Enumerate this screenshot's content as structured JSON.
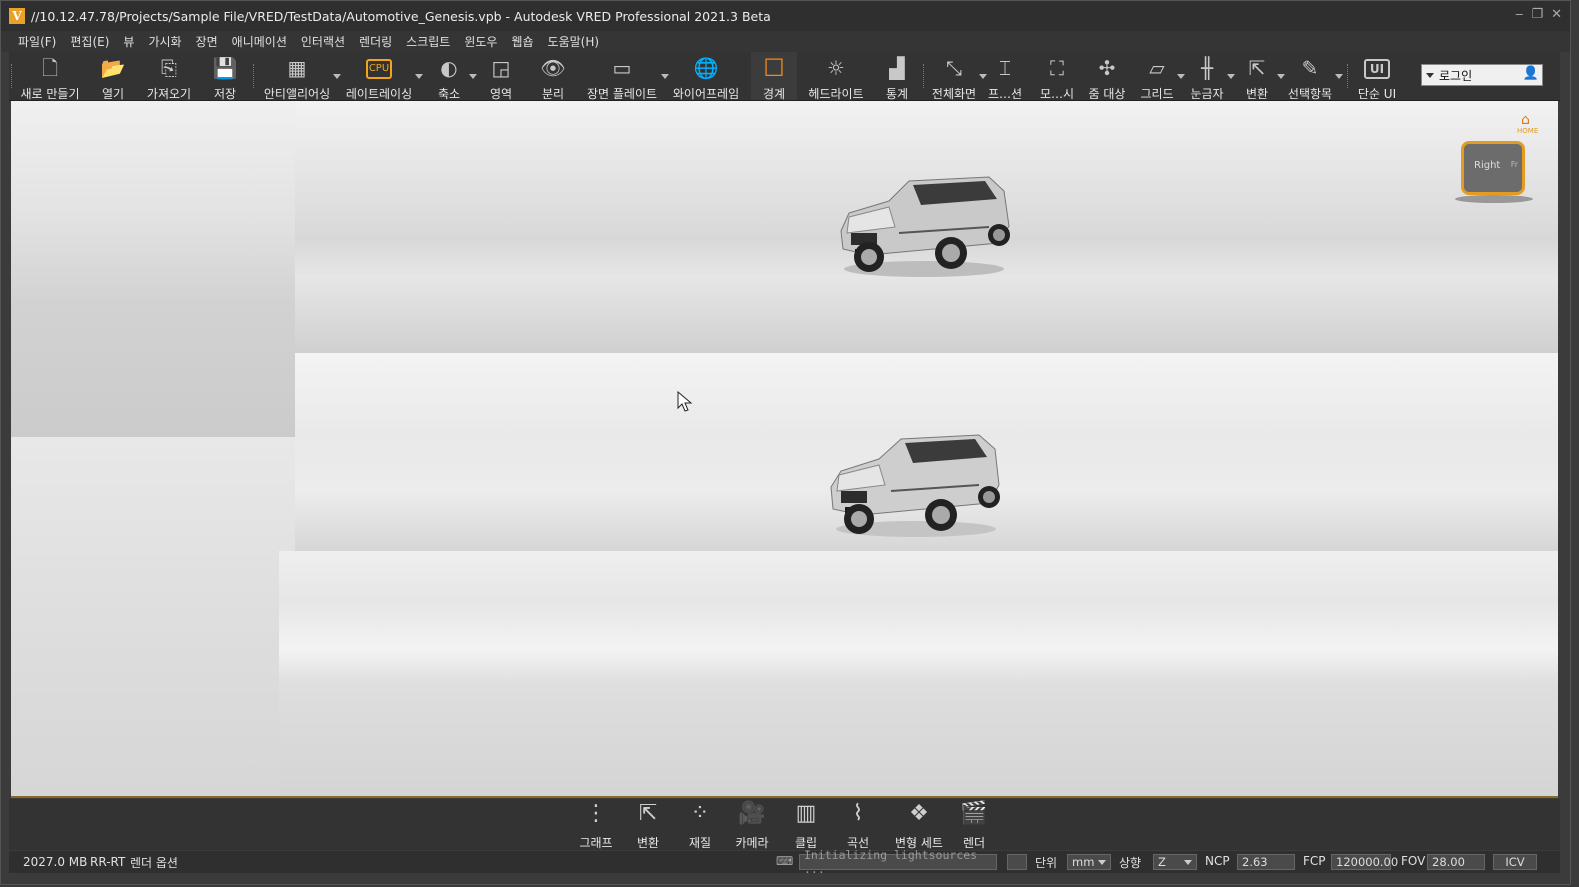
{
  "window": {
    "title": "//10.12.47.78/Projects/Sample File/VRED/TestData/Automotive_Genesis.vpb - Autodesk VRED Professional 2021.3 Beta",
    "logo_letter": "V",
    "controls": [
      "‒",
      "❐",
      "✕"
    ]
  },
  "menu": [
    "파일(F)",
    "편집(E)",
    "뷰",
    "가시화",
    "장면",
    "애니메이션",
    "인터랙션",
    "렌더링",
    "스크립트",
    "윈도우",
    "웹숍",
    "도움말(H)"
  ],
  "toolbar": {
    "buttons": [
      {
        "label": "새로 만들기",
        "icon": "new-file-icon",
        "glyph": "🗋"
      },
      {
        "label": "열기",
        "icon": "open-folder-icon",
        "glyph": "📂"
      },
      {
        "label": "가져오기",
        "icon": "import-icon",
        "glyph": "⎘"
      },
      {
        "label": "저장",
        "icon": "save-icon",
        "glyph": "💾"
      },
      {
        "label": "안티앨리어싱",
        "icon": "antialiasing-icon",
        "glyph": "▦"
      },
      {
        "label": "레이트레이싱",
        "icon": "cpu-icon",
        "glyph": "CPU"
      },
      {
        "label": "축소",
        "icon": "contrast-icon",
        "glyph": "◐"
      },
      {
        "label": "영역",
        "icon": "region-icon",
        "glyph": "◲"
      },
      {
        "label": "분리",
        "icon": "eye-icon",
        "glyph": "👁"
      },
      {
        "label": "장면 플레이트",
        "icon": "scene-plate-icon",
        "glyph": "▭"
      },
      {
        "label": "와이어프레임",
        "icon": "wireframe-globe-icon",
        "glyph": "🌐"
      },
      {
        "label": "경계",
        "icon": "bounding-box-icon",
        "glyph": "☐"
      },
      {
        "label": "헤드라이트",
        "icon": "headlight-icon",
        "glyph": "☼"
      },
      {
        "label": "통계",
        "icon": "statistics-icon",
        "glyph": "▟"
      },
      {
        "label": "전체화면",
        "icon": "fullscreen-icon",
        "glyph": "⤡"
      },
      {
        "label": "프…션",
        "icon": "presentation-icon",
        "glyph": "⌶"
      },
      {
        "label": "모…시",
        "icon": "show-all-icon",
        "glyph": "⛶"
      },
      {
        "label": "줌 대상",
        "icon": "zoom-target-icon",
        "glyph": "✣"
      },
      {
        "label": "그리드",
        "icon": "grid-icon",
        "glyph": "▱"
      },
      {
        "label": "눈금자",
        "icon": "ruler-icon",
        "glyph": "╫"
      },
      {
        "label": "변환",
        "icon": "transform-icon",
        "glyph": "⇱"
      },
      {
        "label": "선택항목",
        "icon": "selection-icon",
        "glyph": "✎"
      },
      {
        "label": "단순 UI",
        "icon": "simple-ui-icon",
        "glyph": "UI"
      }
    ],
    "login_label": "로그인"
  },
  "navcube": {
    "right_label": "Right",
    "front_label": "Fr",
    "home_label": "HOME"
  },
  "dock": [
    {
      "label": "그래프",
      "icon": "graph-icon",
      "glyph": "⋮"
    },
    {
      "label": "변환",
      "icon": "transform-icon",
      "glyph": "⇱"
    },
    {
      "label": "재질",
      "icon": "material-icon",
      "glyph": "⁘"
    },
    {
      "label": "카메라",
      "icon": "camera-icon",
      "glyph": "🎥"
    },
    {
      "label": "클립",
      "icon": "clip-icon",
      "glyph": "▥"
    },
    {
      "label": "곡선",
      "icon": "curve-icon",
      "glyph": "⌇"
    },
    {
      "label": "변형 세트",
      "icon": "variant-set-icon",
      "glyph": "❖"
    },
    {
      "label": "렌더",
      "icon": "render-clapper-icon",
      "glyph": "🎬"
    }
  ],
  "status": {
    "memory": "2027.0 MB",
    "render_mode": "RR-RT",
    "render_options": "렌더 옵션",
    "message": "Initializing lightsources ...",
    "unit_label": "단위",
    "unit_value": "mm",
    "up_label": "상향",
    "up_value": "Z",
    "ncp_label": "NCP",
    "ncp_value": "2.63",
    "fcp_label": "FCP",
    "fcp_value": "120000.00",
    "fov_label": "FOV",
    "fov_value": "28.00",
    "icv_label": "ICV"
  }
}
